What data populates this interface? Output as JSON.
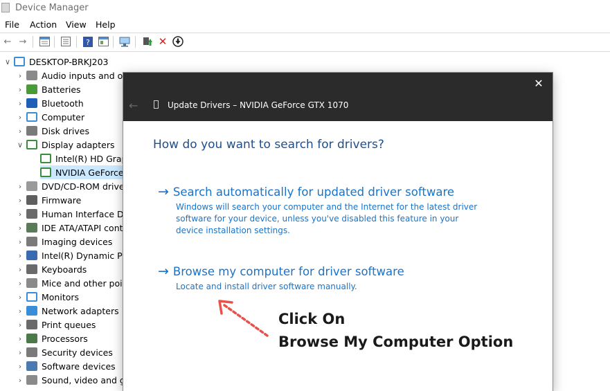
{
  "window": {
    "title": "Device Manager"
  },
  "menu": [
    "File",
    "Action",
    "View",
    "Help"
  ],
  "toolbar": [
    "back-icon",
    "forward-icon",
    "properties-icon",
    "list-icon",
    "help-icon",
    "view-icon",
    "scan-icon",
    "enable-icon",
    "uninstall-icon",
    "update-icon"
  ],
  "tree": {
    "root": "DESKTOP-BRKJ203",
    "items": [
      {
        "label": "Audio inputs and ou",
        "icon": "audio-icon",
        "expanded": false
      },
      {
        "label": "Batteries",
        "icon": "battery-icon",
        "expanded": false
      },
      {
        "label": "Bluetooth",
        "icon": "bluetooth-icon",
        "expanded": false
      },
      {
        "label": "Computer",
        "icon": "computer-icon",
        "expanded": false
      },
      {
        "label": "Disk drives",
        "icon": "disk-icon",
        "expanded": false
      },
      {
        "label": "Display adapters",
        "icon": "display-adapter-icon",
        "expanded": true
      },
      {
        "label": "Intel(R) HD Grapl",
        "icon": "display-adapter-icon",
        "child": true
      },
      {
        "label": "NVIDIA GeForce",
        "icon": "display-adapter-icon",
        "child": true,
        "selected": true
      },
      {
        "label": "DVD/CD-ROM drive",
        "icon": "dvd-icon",
        "expanded": false
      },
      {
        "label": "Firmware",
        "icon": "firmware-icon",
        "expanded": false
      },
      {
        "label": "Human Interface De",
        "icon": "hid-icon",
        "expanded": false
      },
      {
        "label": "IDE ATA/ATAPI contr",
        "icon": "ide-icon",
        "expanded": false
      },
      {
        "label": "Imaging devices",
        "icon": "camera-icon",
        "expanded": false
      },
      {
        "label": "Intel(R) Dynamic Plat",
        "icon": "chip-icon",
        "expanded": false
      },
      {
        "label": "Keyboards",
        "icon": "keyboard-icon",
        "expanded": false
      },
      {
        "label": "Mice and other poir",
        "icon": "mouse-icon",
        "expanded": false
      },
      {
        "label": "Monitors",
        "icon": "monitor-icon",
        "expanded": false
      },
      {
        "label": "Network adapters",
        "icon": "network-icon",
        "expanded": false
      },
      {
        "label": "Print queues",
        "icon": "printer-icon",
        "expanded": false
      },
      {
        "label": "Processors",
        "icon": "processor-icon",
        "expanded": false
      },
      {
        "label": "Security devices",
        "icon": "security-icon",
        "expanded": false
      },
      {
        "label": "Software devices",
        "icon": "software-icon",
        "expanded": false
      },
      {
        "label": "Sound, video and ga",
        "icon": "sound-icon",
        "expanded": false
      }
    ]
  },
  "dialog": {
    "title": "Update Drivers – NVIDIA GeForce GTX 1070",
    "question": "How do you want to search for drivers?",
    "option1": {
      "title": "Search automatically for updated driver software",
      "desc": [
        "Windows will search your computer and the Internet for the latest driver",
        "software for your device, unless you've disabled this feature in your",
        "device installation settings."
      ]
    },
    "option2": {
      "title": "Browse my computer for driver software",
      "desc": "Locate and install driver software manually."
    }
  },
  "annotation": {
    "line1": "Click On",
    "line2": "Browse My Computer Option"
  },
  "colors": {
    "link": "#1a73c9",
    "heading": "#1f4e8c",
    "dialog_header": "#2b2b2b",
    "arrow": "#e8524a",
    "selection": "#cce8ff"
  }
}
